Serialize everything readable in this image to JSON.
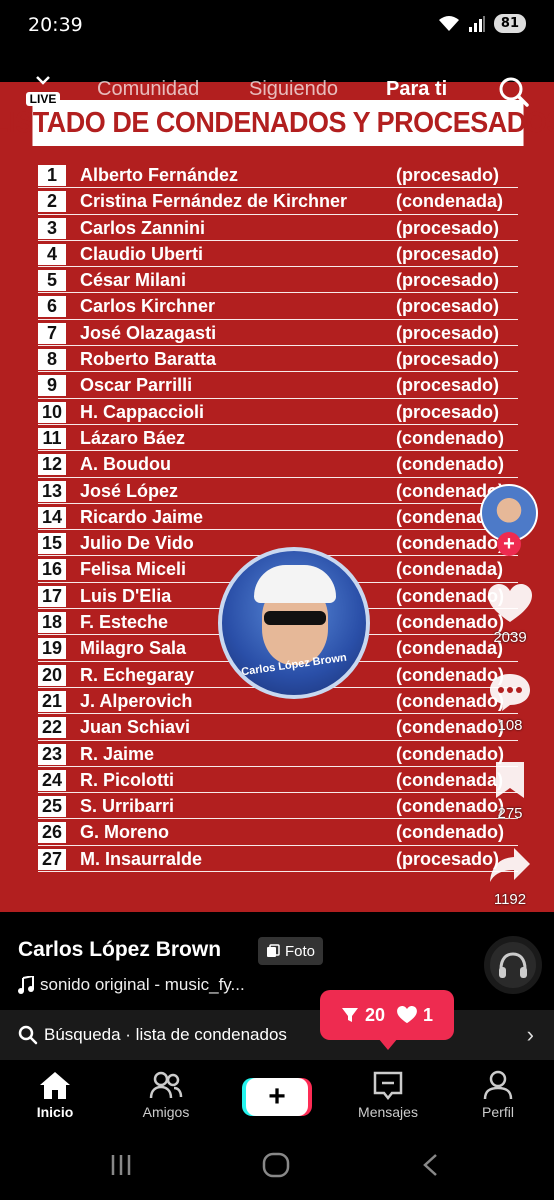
{
  "status_bar": {
    "time": "20:39",
    "battery": "81"
  },
  "top_nav": {
    "live_label": "LIVE",
    "tabs": [
      {
        "label": "Comunidad",
        "active": false
      },
      {
        "label": "Siguiendo",
        "active": false
      },
      {
        "label": "Para ti",
        "active": true
      }
    ]
  },
  "post": {
    "title": "LISTADO DE CONDENADOS Y PROCESADOS",
    "rows": [
      {
        "num": "1",
        "name": "Alberto Fernández",
        "status": "(procesado)"
      },
      {
        "num": "2",
        "name": "Cristina Fernández de Kirchner",
        "status": "(condenada)"
      },
      {
        "num": "3",
        "name": "Carlos Zannini",
        "status": "(procesado)"
      },
      {
        "num": "4",
        "name": "Claudio Uberti",
        "status": "(procesado)"
      },
      {
        "num": "5",
        "name": "César Milani",
        "status": "(procesado)"
      },
      {
        "num": "6",
        "name": "Carlos Kirchner",
        "status": "(procesado)"
      },
      {
        "num": "7",
        "name": "José Olazagasti",
        "status": "(procesado)"
      },
      {
        "num": "8",
        "name": "Roberto Baratta",
        "status": "(procesado)"
      },
      {
        "num": "9",
        "name": "Oscar  Parrilli",
        "status": "(procesado)"
      },
      {
        "num": "10",
        "name": "H. Cappaccioli",
        "status": "(procesado)"
      },
      {
        "num": "11",
        "name": "Lázaro Báez",
        "status": "(condenado)"
      },
      {
        "num": "12",
        "name": "A. Boudou",
        "status": "(condenado)"
      },
      {
        "num": "13",
        "name": "José López",
        "status": "(condenado)"
      },
      {
        "num": "14",
        "name": "Ricardo Jaime",
        "status": "(condenado)"
      },
      {
        "num": "15",
        "name": "Julio De Vido",
        "status": "(condenado)"
      },
      {
        "num": "16",
        "name": "Felisa Miceli",
        "status": "(condenada)"
      },
      {
        "num": "17",
        "name": "Luis D'Elia",
        "status": "(condenado)"
      },
      {
        "num": "18",
        "name": "F. Esteche",
        "status": "(condenado)"
      },
      {
        "num": "19",
        "name": "Milagro Sala",
        "status": "(condenada)"
      },
      {
        "num": "20",
        "name": "R. Echegaray",
        "status": "(condenado)"
      },
      {
        "num": "21",
        "name": "J. Alperovich",
        "status": "(condenado)"
      },
      {
        "num": "22",
        "name": "Juan Schiavi",
        "status": "(condenado)"
      },
      {
        "num": "23",
        "name": "R. Jaime",
        "status": "(condenado)"
      },
      {
        "num": "24",
        "name": "R. Picolotti",
        "status": "(condenada)"
      },
      {
        "num": "25",
        "name": "S. Urribarri",
        "status": "(condenado)"
      },
      {
        "num": "26",
        "name": "G. Moreno",
        "status": "(condenado)"
      },
      {
        "num": "27",
        "name": "M. Insaurralde",
        "status": "(procesado)"
      }
    ],
    "watermark_text": "Carlos López Brown"
  },
  "rail": {
    "likes": "2039",
    "comments": "108",
    "saves": "275",
    "shares": "1192"
  },
  "info": {
    "author": "Carlos López Brown",
    "foto_badge": "Foto",
    "sound": "sonido original - music_fy..."
  },
  "search_bar": {
    "text": "Búsqueda · lista de condenados"
  },
  "bubble": {
    "shares": "20",
    "likes": "1"
  },
  "tabbar": {
    "tabs": [
      {
        "label": "Inicio",
        "active": true
      },
      {
        "label": "Amigos",
        "active": false
      },
      {
        "label": "Mensajes",
        "active": false
      },
      {
        "label": "Perfil",
        "active": false
      }
    ]
  },
  "colors": {
    "post_bg": "#b21f1f",
    "accent": "#ee2b50"
  }
}
